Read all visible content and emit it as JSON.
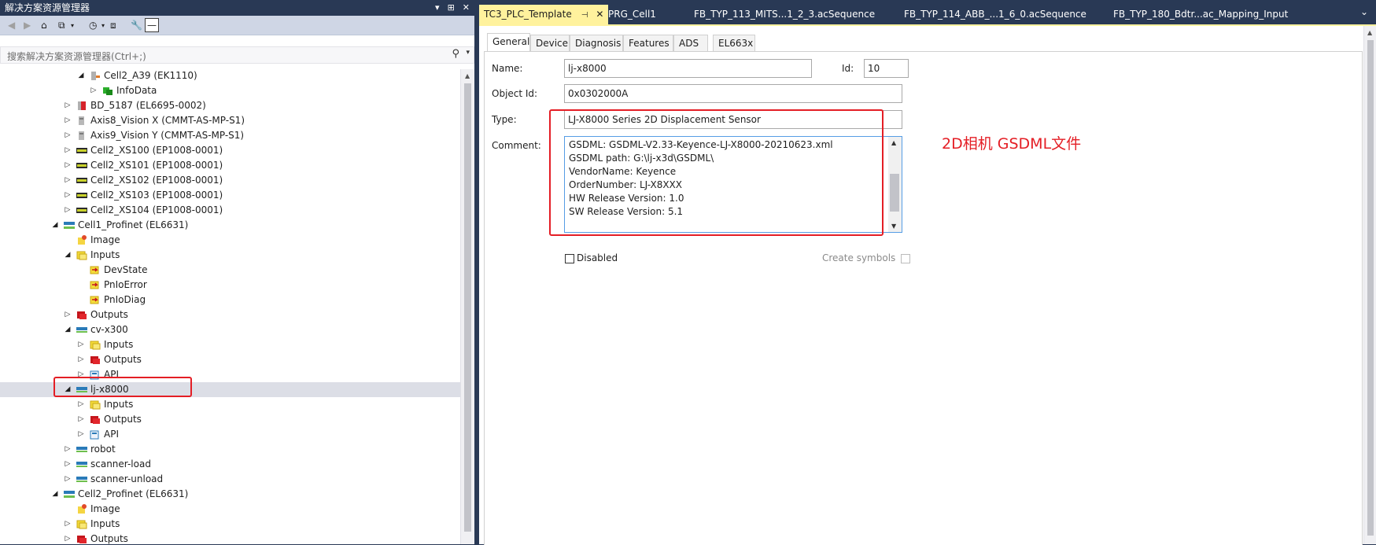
{
  "solution_explorer": {
    "title": "解决方案资源管理器",
    "title_buttons": [
      "▾",
      "⊞",
      "✕"
    ],
    "search_placeholder": "搜索解决方案资源管理器(Ctrl+;)",
    "tree": [
      {
        "label": "Cell2_A39 (EK1110)",
        "depth": 5,
        "expander": "expanded",
        "icon": "coupler-icon"
      },
      {
        "label": "InfoData",
        "depth": 6,
        "expander": "collapsed",
        "icon": "infodata-icon"
      },
      {
        "label": "BD_5187 (EL6695-0002)",
        "depth": 4,
        "expander": "collapsed",
        "icon": "terminal-icon"
      },
      {
        "label": "Axis8_Vision X (CMMT-AS-MP-S1)",
        "depth": 4,
        "expander": "collapsed",
        "icon": "drive-icon"
      },
      {
        "label": "Axis9_Vision Y (CMMT-AS-MP-S1)",
        "depth": 4,
        "expander": "collapsed",
        "icon": "drive-icon"
      },
      {
        "label": "Cell2_XS100 (EP1008-0001)",
        "depth": 4,
        "expander": "collapsed",
        "icon": "box-icon"
      },
      {
        "label": "Cell2_XS101 (EP1008-0001)",
        "depth": 4,
        "expander": "collapsed",
        "icon": "box-icon"
      },
      {
        "label": "Cell2_XS102 (EP1008-0001)",
        "depth": 4,
        "expander": "collapsed",
        "icon": "box-icon"
      },
      {
        "label": "Cell2_XS103 (EP1008-0001)",
        "depth": 4,
        "expander": "collapsed",
        "icon": "box-icon"
      },
      {
        "label": "Cell2_XS104 (EP1008-0001)",
        "depth": 4,
        "expander": "collapsed",
        "icon": "box-icon"
      },
      {
        "label": "Cell1_Profinet (EL6631)",
        "depth": 3,
        "expander": "expanded",
        "icon": "profinet-icon"
      },
      {
        "label": "Image",
        "depth": 4,
        "expander": "none",
        "icon": "image-icon"
      },
      {
        "label": "Inputs",
        "depth": 4,
        "expander": "expanded",
        "icon": "inputs-icon"
      },
      {
        "label": "DevState",
        "depth": 5,
        "expander": "none",
        "icon": "input-var-icon"
      },
      {
        "label": "PnIoError",
        "depth": 5,
        "expander": "none",
        "icon": "input-var-icon"
      },
      {
        "label": "PnIoDiag",
        "depth": 5,
        "expander": "none",
        "icon": "input-var-icon"
      },
      {
        "label": "Outputs",
        "depth": 4,
        "expander": "collapsed",
        "icon": "outputs-icon"
      },
      {
        "label": "cv-x300",
        "depth": 4,
        "expander": "expanded",
        "icon": "device-icon"
      },
      {
        "label": "Inputs",
        "depth": 5,
        "expander": "collapsed",
        "icon": "inputs-icon"
      },
      {
        "label": "Outputs",
        "depth": 5,
        "expander": "collapsed",
        "icon": "outputs-icon"
      },
      {
        "label": "API",
        "depth": 5,
        "expander": "collapsed",
        "icon": "api-icon"
      },
      {
        "label": "lj-x8000",
        "depth": 4,
        "expander": "expanded",
        "icon": "device-icon",
        "selected": true
      },
      {
        "label": "Inputs",
        "depth": 5,
        "expander": "collapsed",
        "icon": "inputs-icon"
      },
      {
        "label": "Outputs",
        "depth": 5,
        "expander": "collapsed",
        "icon": "outputs-icon"
      },
      {
        "label": "API",
        "depth": 5,
        "expander": "collapsed",
        "icon": "api-icon"
      },
      {
        "label": "robot",
        "depth": 4,
        "expander": "collapsed",
        "icon": "device-icon"
      },
      {
        "label": "scanner-load",
        "depth": 4,
        "expander": "collapsed",
        "icon": "device-icon"
      },
      {
        "label": "scanner-unload",
        "depth": 4,
        "expander": "collapsed",
        "icon": "device-icon"
      },
      {
        "label": "Cell2_Profinet (EL6631)",
        "depth": 3,
        "expander": "expanded",
        "icon": "profinet-icon"
      },
      {
        "label": "Image",
        "depth": 4,
        "expander": "none",
        "icon": "image-icon"
      },
      {
        "label": "Inputs",
        "depth": 4,
        "expander": "collapsed",
        "icon": "inputs-icon"
      },
      {
        "label": "Outputs",
        "depth": 4,
        "expander": "collapsed",
        "icon": "outputs-icon"
      }
    ]
  },
  "editor": {
    "tabs": [
      {
        "label": "TC3_PLC_Template",
        "active": true
      },
      {
        "label": "PRG_Cell1",
        "active": false
      },
      {
        "label": "FB_TYP_113_MITS...1_2_3.acSequence",
        "active": false
      },
      {
        "label": "FB_TYP_114_ABB_...1_6_0.acSequence",
        "active": false
      },
      {
        "label": "FB_TYP_180_Bdtr...ac_Mapping_Input",
        "active": false
      }
    ],
    "subtabs": [
      "General",
      "Device",
      "Diagnosis",
      "Features",
      "ADS",
      "EL663x"
    ],
    "general": {
      "name_label": "Name:",
      "name_value": "lj-x8000",
      "id_label": "Id:",
      "id_value": "10",
      "objectid_label": "Object Id:",
      "objectid_value": "0x0302000A",
      "type_label": "Type:",
      "type_value": "LJ-X8000 Series 2D Displacement Sensor",
      "comment_label": "Comment:",
      "comment_lines": [
        "GSDML: GSDML-V2.33-Keyence-LJ-X8000-20210623.xml",
        "GSDML path: G:\\lj-x3d\\GSDML\\",
        "VendorName: Keyence",
        "OrderNumber: LJ-X8XXX",
        "HW Release Version: 1.0",
        "SW Release Version: 5.1"
      ],
      "disabled_label": "Disabled",
      "create_symbols_label": "Create symbols"
    }
  },
  "annotation": "2D相机 GSDML文件",
  "colors": {
    "accent": "#e41e25",
    "tab_active": "#fff29d",
    "chrome": "#293955"
  }
}
